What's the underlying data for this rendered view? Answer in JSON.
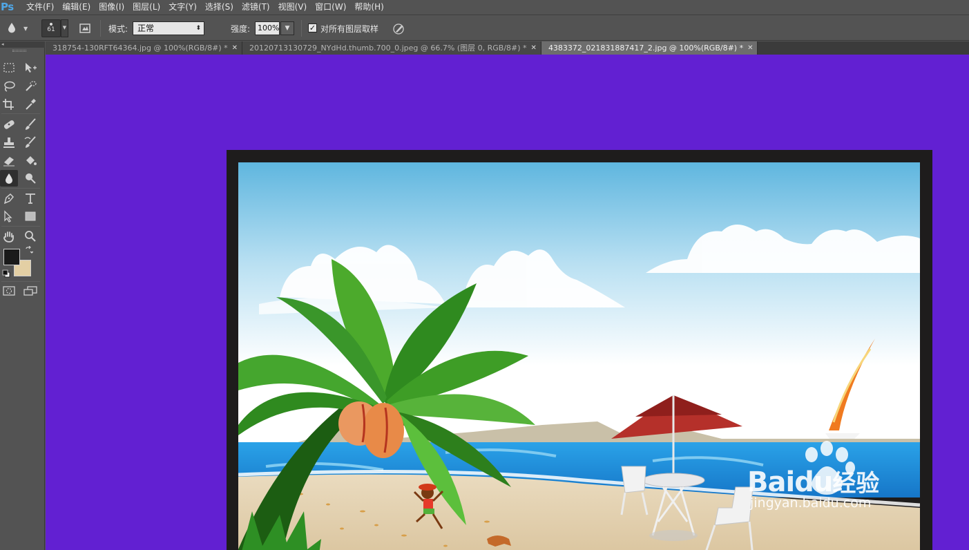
{
  "app": {
    "logo": "Ps"
  },
  "menu": [
    "文件(F)",
    "编辑(E)",
    "图像(I)",
    "图层(L)",
    "文字(Y)",
    "选择(S)",
    "滤镜(T)",
    "视图(V)",
    "窗口(W)",
    "帮助(H)"
  ],
  "options": {
    "brush_size": "61",
    "mode_label": "模式:",
    "mode_value": "正常",
    "strength_label": "强度:",
    "strength_value": "100%",
    "sample_all_layers_label": "对所有图层取样",
    "sample_all_layers_checked": true
  },
  "tabs": [
    {
      "label": "318754-130RFT64364.jpg @ 100%(RGB/8#) *",
      "active": false
    },
    {
      "label": "20120713130729_NYdHd.thumb.700_0.jpeg @ 66.7% (图层 0, RGB/8#) *",
      "active": false
    },
    {
      "label": "4383372_021831887417_2.jpg @ 100%(RGB/8#) *",
      "active": true
    }
  ],
  "tools": [
    "rectangular-marquee-tool",
    "move-tool",
    "lasso-tool",
    "quick-selection-tool",
    "crop-tool",
    "eyedropper-tool",
    "spot-healing-brush-tool",
    "brush-tool",
    "clone-stamp-tool",
    "history-brush-tool",
    "eraser-tool",
    "paint-bucket-tool",
    "blur-tool",
    "dodge-tool",
    "pen-tool",
    "type-tool",
    "path-selection-tool",
    "rectangle-tool",
    "hand-tool",
    "zoom-tool",
    "quick-mask-tool",
    "screen-mode-tool"
  ],
  "colors": {
    "workspace_bg": "#6220d2",
    "foreground": "#1a1a1a",
    "background": "#e3cfa4"
  },
  "watermark": {
    "brand": "Baidu",
    "brand_cn": "经验",
    "url": "jingyan.baidu.com"
  }
}
